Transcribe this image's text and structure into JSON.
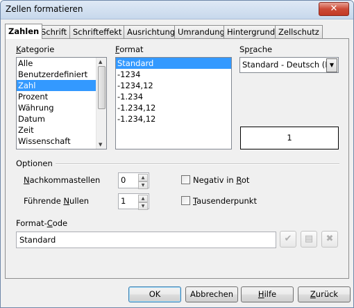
{
  "window": {
    "title": "Zellen formatieren",
    "close_symbol": "✕"
  },
  "tabs": [
    {
      "label": "Zahlen",
      "active": true
    },
    {
      "label": "Schrift"
    },
    {
      "label": "Schrifteffekt"
    },
    {
      "label": "Ausrichtung"
    },
    {
      "label": "Umrandung"
    },
    {
      "label": "Hintergrund"
    },
    {
      "label": "Zellschutz"
    }
  ],
  "kategorie": {
    "label": "Kategorie",
    "items": [
      "Alle",
      "Benutzerdefiniert",
      "Zahl",
      "Prozent",
      "Währung",
      "Datum",
      "Zeit",
      "Wissenschaft"
    ],
    "selected": "Zahl"
  },
  "format": {
    "label": "Format",
    "items": [
      "Standard",
      "-1234",
      "-1234,12",
      "-1.234",
      "-1.234,12",
      "-1.234,12"
    ],
    "selected": "Standard"
  },
  "sprache": {
    "label": "Sprache",
    "value": "Standard - Deutsch (De"
  },
  "preview": {
    "value": "1"
  },
  "optionen": {
    "label": "Optionen",
    "nachkommastellen": {
      "label": "Nachkommastellen",
      "value": "0"
    },
    "fuehrende_nullen": {
      "label": "Führende Nullen",
      "value": "1"
    },
    "negativ_in_rot": {
      "label": "Negativ in Rot",
      "checked": false
    },
    "tausenderpunkt": {
      "label": "Tausenderpunkt",
      "checked": false
    }
  },
  "format_code": {
    "label": "Format-Code",
    "value": "Standard"
  },
  "buttons": {
    "ok": "OK",
    "abbrechen": "Abbrechen",
    "hilfe": "Hilfe",
    "zurueck": "Zurück"
  },
  "icons": {
    "accept": "checkmark-icon",
    "comment": "comment-icon",
    "delete": "delete-icon"
  }
}
